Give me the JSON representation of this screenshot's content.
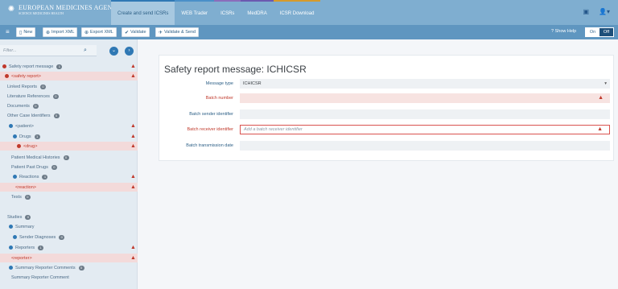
{
  "header": {
    "logo_line1": "EUROPEAN MEDICINES AGENCY",
    "logo_line2": "SCIENCE  MEDICINES  HEALTH",
    "tabs": [
      {
        "label": "Create and send ICSRs"
      },
      {
        "label": "WEB Trader"
      },
      {
        "label": "ICSRs"
      },
      {
        "label": "MedDRA"
      },
      {
        "label": "ICSR Download"
      }
    ]
  },
  "toolbar": {
    "new_label": "New",
    "import_label": "Import XML",
    "export_label": "Export XML",
    "validate_label": "Validate",
    "validate_send_label": "Validate & Send",
    "show_help_label": "Show Help",
    "toggle_on": "On",
    "toggle_off": "Off"
  },
  "sidebar": {
    "filter_placeholder": "Filter...",
    "items": [
      {
        "label": "Safety report message",
        "count": "1"
      },
      {
        "label": "<safety report>"
      },
      {
        "label": "Linked Reports",
        "count": "0"
      },
      {
        "label": "Literature References",
        "count": "0"
      },
      {
        "label": "Documents",
        "count": "0"
      },
      {
        "label": "Other Case Identifiers",
        "count": "0"
      },
      {
        "label": "<patient>"
      },
      {
        "label": "Drugs",
        "count": "1"
      },
      {
        "label": "<drug>"
      },
      {
        "label": "Patient Medical Histories",
        "count": "0"
      },
      {
        "label": "Patient Past Drugs",
        "count": "0"
      },
      {
        "label": "Reactions",
        "count": "1"
      },
      {
        "label": "<reaction>"
      },
      {
        "label": "Tests",
        "count": "0"
      },
      {
        "label": "Studies",
        "count": "0"
      },
      {
        "label": "Summary"
      },
      {
        "label": "Sender Diagnoses",
        "count": "0"
      },
      {
        "label": "Reporters",
        "count": "1"
      },
      {
        "label": "<reporter>"
      },
      {
        "label": "Summary Reporter Comments",
        "count": "0"
      },
      {
        "label": "Summary Reporter Comment"
      }
    ]
  },
  "main": {
    "title": "Safety report message: ICHICSR",
    "fields": [
      {
        "label": "Message type",
        "value": "ICHICSR"
      },
      {
        "label": "Batch number",
        "value": ""
      },
      {
        "label": "Batch sender identifier",
        "value": ""
      },
      {
        "label": "Batch receiver identifier",
        "placeholder": "Add a batch receiver identifier"
      },
      {
        "label": "Batch transmission date",
        "value": ""
      }
    ]
  },
  "colors": {
    "header_bg": "#7faed0",
    "toolbar_bg": "#5f96c0",
    "error_red": "#c0392b",
    "accent_blue": "#2f78b4"
  }
}
